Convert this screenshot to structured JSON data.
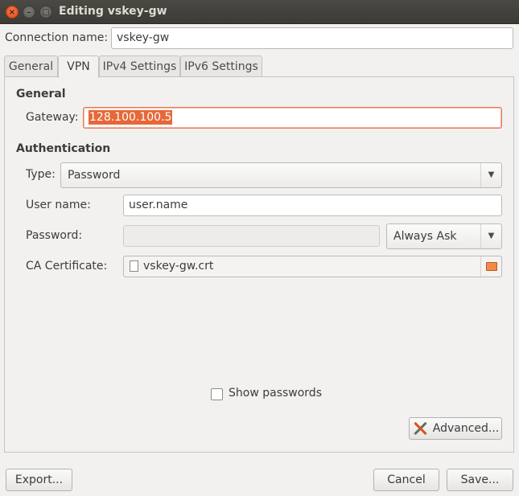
{
  "window": {
    "title": "Editing vskey-gw",
    "close_glyph": "×",
    "min_glyph": "–",
    "max_glyph": "□"
  },
  "connection": {
    "label": "Connection name:",
    "value": "vskey-gw"
  },
  "tabs": [
    {
      "label": "General"
    },
    {
      "label": "VPN"
    },
    {
      "label": "IPv4 Settings"
    },
    {
      "label": "IPv6 Settings"
    }
  ],
  "general": {
    "heading": "General",
    "gateway_label": "Gateway:",
    "gateway_value": "128.100.100.5"
  },
  "auth": {
    "heading": "Authentication",
    "type_label": "Type:",
    "type_value": "Password",
    "username_label": "User name:",
    "username_value": "user.name",
    "password_label": "Password:",
    "password_value": "",
    "password_mode": "Always Ask",
    "ca_label": "CA Certificate:",
    "ca_value": "vskey-gw.crt"
  },
  "show_passwords": {
    "label": "Show passwords",
    "checked": false
  },
  "buttons": {
    "advanced": "Advanced...",
    "export": "Export...",
    "cancel": "Cancel",
    "save": "Save..."
  },
  "icons": {
    "close": "close-icon",
    "advanced": "tools-icon",
    "file": "document-icon",
    "folder": "folder-open-icon"
  },
  "colors": {
    "titlebar": "#3c3b37",
    "accent": "#e66838",
    "window_bg": "#f2f1f0"
  }
}
